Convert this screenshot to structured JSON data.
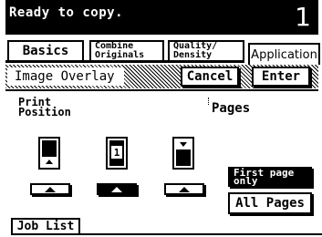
{
  "status": {
    "message": "Ready to copy.",
    "copy_count": "1"
  },
  "tabs": {
    "basics": "Basics",
    "combine_line1": "Combine",
    "combine_line2": "Originals",
    "quality_line1": "Quality/",
    "quality_line2": "Density",
    "application": "Application"
  },
  "panel": {
    "title": "Image Overlay",
    "cancel_label": "Cancel",
    "enter_label": "Enter",
    "print_position_line1": "Print",
    "print_position_line2": "Position",
    "center_page_number": "1",
    "pages_label": "Pages",
    "first_page_line1": "First page",
    "first_page_line2": "only",
    "all_pages_label": "All Pages",
    "selected_position": "center",
    "selected_pages": "first-page-only"
  },
  "footer": {
    "job_list_label": "Job List"
  },
  "colors": {
    "foreground": "#000000",
    "background": "#ffffff"
  }
}
